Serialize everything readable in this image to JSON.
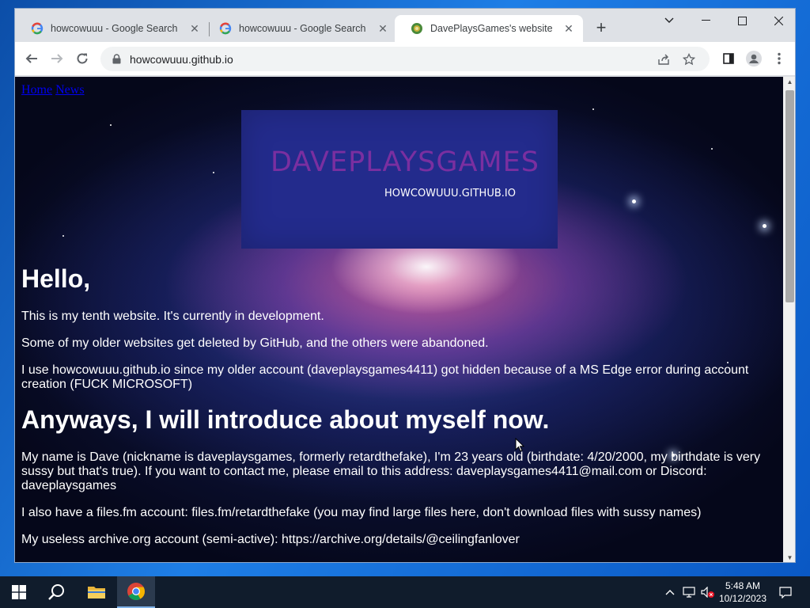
{
  "browser": {
    "tabs": [
      {
        "title": "howcowuuu - Google Search",
        "favicon": "google-icon"
      },
      {
        "title": "howcowuuu - Google Search",
        "favicon": "google-icon"
      },
      {
        "title": "DavePlaysGames's website",
        "favicon": "site-icon",
        "active": true
      }
    ],
    "url": "howcowuuu.github.io"
  },
  "page": {
    "nav": [
      "Home",
      "News"
    ],
    "banner_title": "DAVEPLAYSGAMES",
    "banner_subtitle": "HOWCOWUUU.GITHUB.IO",
    "heading1": "Hello,",
    "p1": "This is my tenth website. It's currently in development.",
    "p2": "Some of my older websites get deleted by GitHub, and the others were abandoned.",
    "p3": "I use howcowuuu.github.io since my older account (daveplaysgames4411) got hidden because of a MS Edge error during account creation (FUCK MICROSOFT)",
    "heading2": "Anyways, I will introduce about myself now.",
    "p4": "My name is Dave (nickname is daveplaysgames, formerly retardthefake), I'm 23 years old (birthdate: 4/20/2000, my birthdate is very sussy but that's true). If you want to contact me, please email to this address: daveplaysgames4411@mail.com or Discord: daveplaysgames",
    "p5": "I also have a files.fm account: files.fm/retardthefake (you may find large files here, don't download files with sussy names)",
    "p6": "My useless archive.org account (semi-active): https://archive.org/details/@ceilingfanlover"
  },
  "taskbar": {
    "time": "5:48 AM",
    "date": "10/12/2023"
  },
  "colors": {
    "banner_bg": "#232b8c",
    "banner_title": "#7a2fa0",
    "link": "#0000ee"
  }
}
